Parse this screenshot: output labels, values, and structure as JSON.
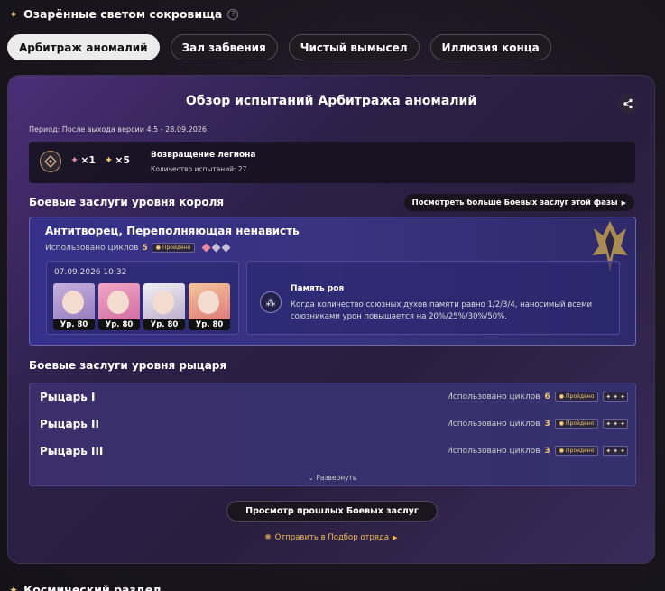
{
  "header": {
    "title": "Озарённые светом сокровища"
  },
  "tabs": [
    {
      "label": "Арбитраж аномалий",
      "active": true
    },
    {
      "label": "Зал забвения",
      "active": false
    },
    {
      "label": "Чистый вымысел",
      "active": false
    },
    {
      "label": "Иллюзия конца",
      "active": false
    }
  ],
  "panel": {
    "title": "Обзор испытаний Арбитража аномалий",
    "period": "Период: После выхода версии 4.5 - 28.09.2026",
    "legion": {
      "badge1": "×1",
      "badge2": "×5",
      "name": "Возвращение легиона",
      "count": "Количество испытаний: 27"
    },
    "king_section": {
      "title": "Боевые заслуги уровня короля",
      "more_button": "Посмотреть больше Боевых заслуг этой фазы",
      "boss_name": "Антитворец, Переполняющая ненависть",
      "cycles_label": "Использовано циклов",
      "cycles_value": "5",
      "passed_badge": "Пройдено",
      "team_date": "07.09.2026 10:32",
      "characters": [
        {
          "level": "Ур. 80"
        },
        {
          "level": "Ур. 80"
        },
        {
          "level": "Ур. 80"
        },
        {
          "level": "Ур. 80"
        }
      ],
      "buff_name": "Память роя",
      "buff_desc": "Когда количество союзных духов памяти равно 1/2/3/4, наносимый всеми союзниками урон повышается на 20%/25%/30%/50%."
    },
    "knight_section": {
      "title": "Боевые заслуги уровня рыцаря",
      "rows": [
        {
          "name": "Рыцарь I",
          "cycles_label": "Использовано циклов",
          "cycles": "6",
          "passed": "Пройдено"
        },
        {
          "name": "Рыцарь II",
          "cycles_label": "Использовано циклов",
          "cycles": "3",
          "passed": "Пройдено"
        },
        {
          "name": "Рыцарь III",
          "cycles_label": "Использовано циклов",
          "cycles": "3",
          "passed": "Пройдено"
        }
      ],
      "expand_label": "Развернуть"
    },
    "past_button": "Просмотр прошлых Боевых заслуг",
    "send_link": "Отправить в Подбор отряда"
  },
  "footer_title": "Космический раздел"
}
